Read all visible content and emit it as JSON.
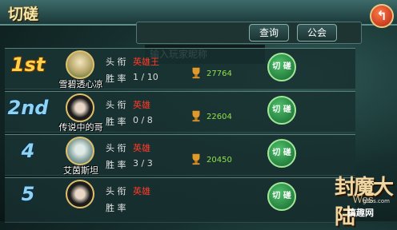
{
  "header": {
    "title": "切磋",
    "back_label": "↰"
  },
  "search": {
    "placeholder": "输入玩家昵称",
    "query_label": "查询",
    "guild_label": "公会"
  },
  "labels": {
    "title_prefix": "头 衔",
    "rate_prefix": "胜 率",
    "challenge": "切 磋"
  },
  "rows": [
    {
      "rank": "1st",
      "name": "雪碧透心凉",
      "title": "英雄王",
      "rate": "1 / 10",
      "points": "27764"
    },
    {
      "rank": "2nd",
      "name": "传说中的哥",
      "title": "英雄",
      "rate": "0 / 8",
      "points": "22604"
    },
    {
      "rank": "4",
      "name": "艾茵斯坦",
      "title": "英雄",
      "rate": "3 / 3",
      "points": "20450"
    },
    {
      "rank": "5",
      "name": "",
      "title": "英雄",
      "rate": "",
      "points": ""
    }
  ],
  "logo": {
    "text": "封魔大陆",
    "sub": "Wes"
  },
  "watermark": {
    "site": "gdos.com",
    "text": "搞趣网"
  },
  "colors": {
    "accent_gold": "#ffd24a",
    "rank_blue": "#8fd2f1",
    "title_red": "#ff3c2b",
    "points_green": "#8fe04a",
    "button_green": "#2f9a4a"
  }
}
